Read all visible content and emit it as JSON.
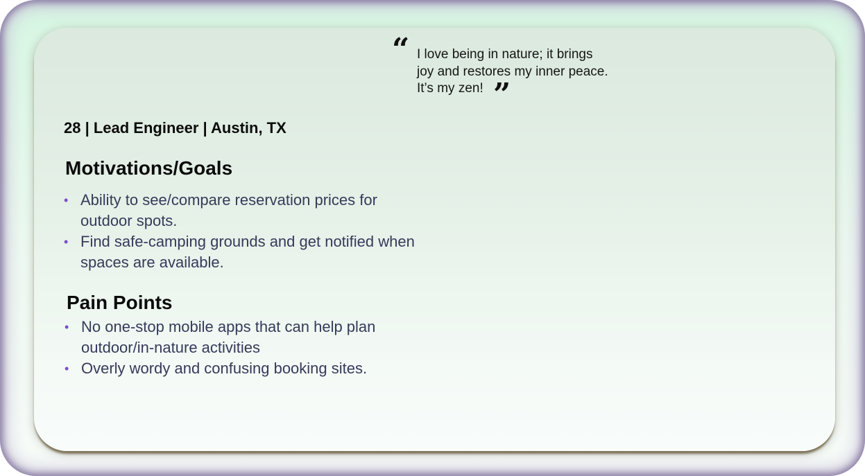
{
  "quote": {
    "open_mark": "“",
    "close_mark": "”",
    "lines": [
      "I love being in nature; it brings",
      "joy and restores my inner peace.",
      "It’s my zen!"
    ]
  },
  "persona": {
    "demographics": "28 | Lead Engineer | Austin, TX"
  },
  "motivations": {
    "heading": "Motivations/Goals",
    "items": [
      {
        "lines": [
          "Ability to see/compare reservation prices for",
          "outdoor spots."
        ]
      },
      {
        "lines": [
          "Find safe-camping grounds and get notified when",
          "spaces are available."
        ]
      }
    ]
  },
  "pain_points": {
    "heading": "Pain Points",
    "items": [
      {
        "lines": [
          "No one-stop mobile apps that can help plan",
          "outdoor/in-nature activities"
        ]
      },
      {
        "lines": [
          "Overly wordy and confusing booking sites."
        ]
      }
    ]
  },
  "colors": {
    "bullet": "#7a4fc7",
    "body_text": "#363a5a",
    "heading_text": "#0b0b0b",
    "frame_border": "#8c7fa5"
  }
}
